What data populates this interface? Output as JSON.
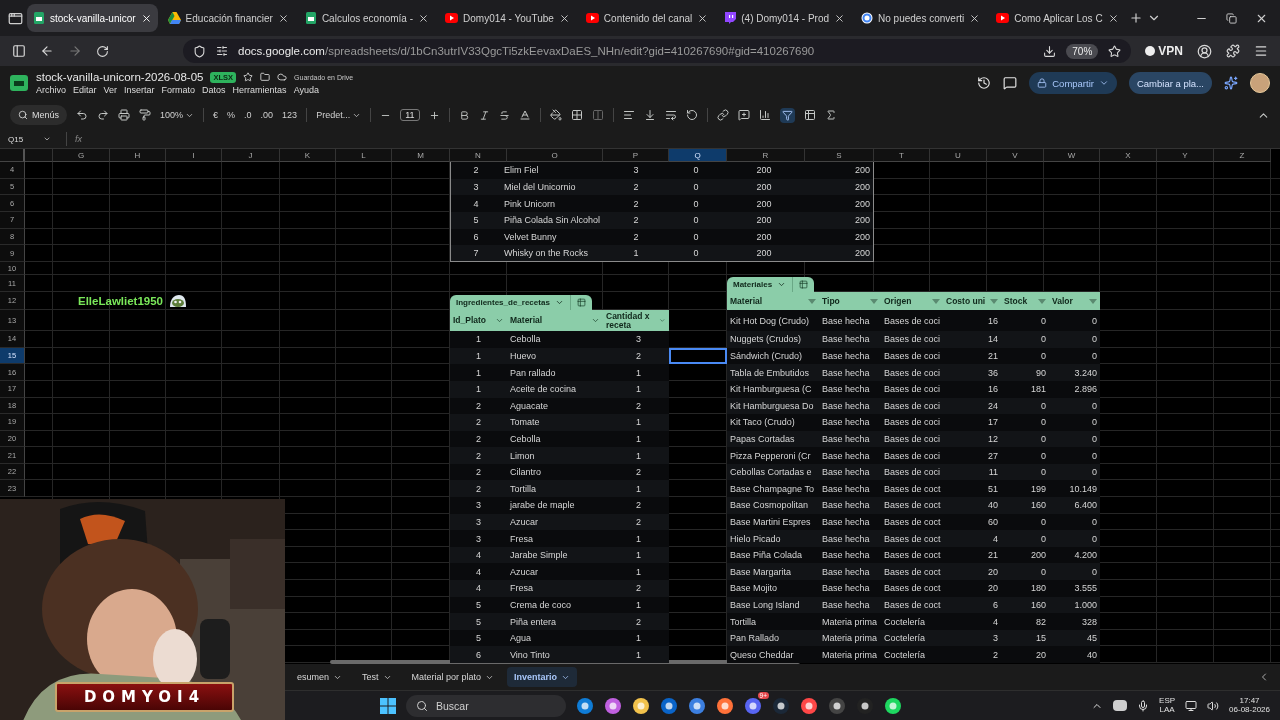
{
  "browser": {
    "tabs": [
      {
        "kind": "sheets",
        "title": "stock-vanilla-unicor",
        "selected": true
      },
      {
        "kind": "drive",
        "title": "Educación financier",
        "selected": false
      },
      {
        "kind": "sheets",
        "title": "Calculos economía -",
        "selected": false
      },
      {
        "kind": "youtube",
        "title": "Domy014 - YouTube",
        "selected": false
      },
      {
        "kind": "youtube",
        "title": "Contenido del canal",
        "selected": false
      },
      {
        "kind": "twitch",
        "title": "(4) Domy014 - Prod",
        "selected": false
      },
      {
        "kind": "google",
        "title": "No puedes converti",
        "selected": false
      },
      {
        "kind": "youtube",
        "title": "Como Aplicar Los C",
        "selected": false
      }
    ],
    "url_host": "docs.google.com",
    "url_path": "/spreadsheets/d/1bCn3utrIV33QgcTi5zkEevaxDaES_NHn/edit?gid=410267690#gid=410267690",
    "zoom": "70%",
    "vpn": "VPN"
  },
  "doc": {
    "title": "stock-vanilla-unicorn-2026-08-05",
    "badge": "XLSX",
    "save_status": "Guardado en Drive",
    "menus": [
      "Archivo",
      "Editar",
      "Ver",
      "Insertar",
      "Formato",
      "Datos",
      "Herramientas",
      "Ayuda"
    ],
    "share": "Compartir",
    "switch_button": "Cambiar a pla..."
  },
  "toolbar": {
    "search": "Menús",
    "zoom": "100%",
    "currency": "€",
    "percent": "%",
    "decrease_decimals": ".0",
    "increase_decimals": ".00",
    "number_format": "123",
    "font": "Predet...",
    "font_size": "11",
    "filter_on": true
  },
  "formula_bar": {
    "cell": "Q15",
    "label": "fx"
  },
  "grid": {
    "columns": [
      {
        "label": "G",
        "selected": false
      },
      {
        "label": "H",
        "selected": false
      },
      {
        "label": "I",
        "selected": false
      },
      {
        "label": "J",
        "selected": false
      },
      {
        "label": "K",
        "selected": false
      },
      {
        "label": "L",
        "selected": false
      },
      {
        "label": "M",
        "selected": false
      },
      {
        "label": "N",
        "selected": false
      },
      {
        "label": "O",
        "selected": false
      },
      {
        "label": "P",
        "selected": false
      },
      {
        "label": "Q",
        "selected": true
      },
      {
        "label": "R",
        "selected": false
      },
      {
        "label": "S",
        "selected": false
      },
      {
        "label": "T",
        "selected": false
      },
      {
        "label": "U",
        "selected": false
      },
      {
        "label": "V",
        "selected": false
      },
      {
        "label": "W",
        "selected": false
      },
      {
        "label": "X",
        "selected": false
      },
      {
        "label": "Y",
        "selected": false
      },
      {
        "label": "Z",
        "selected": false
      }
    ],
    "row_numbers": [
      {
        "label": "4",
        "selected": false
      },
      {
        "label": "5",
        "selected": false
      },
      {
        "label": "6",
        "selected": false
      },
      {
        "label": "7",
        "selected": false
      },
      {
        "label": "8",
        "selected": false
      },
      {
        "label": "9",
        "selected": false
      },
      {
        "label": "10",
        "selected": false
      },
      {
        "label": "11",
        "selected": false
      },
      {
        "label": "12",
        "selected": false
      },
      {
        "label": "13",
        "selected": false
      },
      {
        "label": "14",
        "selected": false
      },
      {
        "label": "15",
        "selected": true
      },
      {
        "label": "16",
        "selected": false
      },
      {
        "label": "17",
        "selected": false
      },
      {
        "label": "18",
        "selected": false
      },
      {
        "label": "19",
        "selected": false
      },
      {
        "label": "20",
        "selected": false
      },
      {
        "label": "21",
        "selected": false
      },
      {
        "label": "22",
        "selected": false
      },
      {
        "label": "23",
        "selected": false
      }
    ]
  },
  "chat": {
    "user": "ElleLawliet1950"
  },
  "summary_table": {
    "rows": [
      [
        "2",
        "Elim Fiel",
        "3",
        "0",
        "200",
        "200"
      ],
      [
        "3",
        "Miel del Unicornio",
        "2",
        "0",
        "200",
        "200"
      ],
      [
        "4",
        "Pink Unicorn",
        "2",
        "0",
        "200",
        "200"
      ],
      [
        "5",
        "Piña Colada Sin Alcohol",
        "2",
        "0",
        "200",
        "200"
      ],
      [
        "6",
        "Velvet Bunny",
        "2",
        "0",
        "200",
        "200"
      ],
      [
        "7",
        "Whisky on the Rocks",
        "1",
        "0",
        "200",
        "200"
      ]
    ]
  },
  "ingredients_table": {
    "name": "Ingredientes_de_recetas",
    "columns": [
      "Id_Plato",
      "Material",
      "Cantidad x receta"
    ],
    "rows": [
      [
        "1",
        "Cebolla",
        "3"
      ],
      [
        "1",
        "Huevo",
        "2"
      ],
      [
        "1",
        "Pan rallado",
        "1"
      ],
      [
        "1",
        "Aceite de cocina",
        "1"
      ],
      [
        "2",
        "Aguacate",
        "2"
      ],
      [
        "2",
        "Tomate",
        "1"
      ],
      [
        "2",
        "Cebolla",
        "1"
      ],
      [
        "2",
        "Limon",
        "1"
      ],
      [
        "2",
        "Cilantro",
        "2"
      ],
      [
        "2",
        "Tortilla",
        "1"
      ],
      [
        "3",
        "jarabe de maple",
        "2"
      ],
      [
        "3",
        "Azucar",
        "2"
      ],
      [
        "3",
        "Fresa",
        "1"
      ],
      [
        "4",
        "Jarabe Simple",
        "1"
      ],
      [
        "4",
        "Azucar",
        "1"
      ],
      [
        "4",
        "Fresa",
        "2"
      ],
      [
        "5",
        "Crema de coco",
        "1"
      ],
      [
        "5",
        "Piña entera",
        "2"
      ],
      [
        "5",
        "Agua",
        "1"
      ],
      [
        "6",
        "Vino Tinto",
        "1"
      ]
    ]
  },
  "materials_table": {
    "name": "Materiales",
    "columns": [
      "Material",
      "Tipo",
      "Origen",
      "Costo uni",
      "Stock",
      "Valor"
    ],
    "rows": [
      [
        "Kit Hot Dog (Crudo)",
        "Base hecha",
        "Bases de coci",
        "16",
        "0",
        "0"
      ],
      [
        "Nuggets (Crudos)",
        "Base hecha",
        "Bases de coci",
        "14",
        "0",
        "0"
      ],
      [
        "Sándwich (Crudo)",
        "Base hecha",
        "Bases de coci",
        "21",
        "0",
        "0"
      ],
      [
        "Tabla de Embutidos",
        "Base hecha",
        "Bases de coci",
        "36",
        "90",
        "3.240"
      ],
      [
        "Kit Hamburguesa (C",
        "Base hecha",
        "Bases de coci",
        "16",
        "181",
        "2.896"
      ],
      [
        "Kit Hamburguesa Do",
        "Base hecha",
        "Bases de coci",
        "24",
        "0",
        "0"
      ],
      [
        "Kit Taco (Crudo)",
        "Base hecha",
        "Bases de coci",
        "17",
        "0",
        "0"
      ],
      [
        "Papas Cortadas",
        "Base hecha",
        "Bases de coci",
        "12",
        "0",
        "0"
      ],
      [
        "Pizza Pepperoni (Cr",
        "Base hecha",
        "Bases de coci",
        "27",
        "0",
        "0"
      ],
      [
        "Cebollas Cortadas e",
        "Base hecha",
        "Bases de coci",
        "11",
        "0",
        "0"
      ],
      [
        "Base Champagne To",
        "Base hecha",
        "Bases de coct",
        "51",
        "199",
        "10.149"
      ],
      [
        "Base Cosmopolitan",
        "Base hecha",
        "Bases de coct",
        "40",
        "160",
        "6.400"
      ],
      [
        "Base Martini Espres",
        "Base hecha",
        "Bases de coct",
        "60",
        "0",
        "0"
      ],
      [
        "Hielo Picado",
        "Base hecha",
        "Bases de coct",
        "4",
        "0",
        "0"
      ],
      [
        "Base Piña Colada",
        "Base hecha",
        "Bases de coct",
        "21",
        "200",
        "4.200"
      ],
      [
        "Base Margarita",
        "Base hecha",
        "Bases de coct",
        "20",
        "0",
        "0"
      ],
      [
        "Base Mojito",
        "Base hecha",
        "Bases de coct",
        "20",
        "180",
        "3.555"
      ],
      [
        "Base Long Island",
        "Base hecha",
        "Bases de coct",
        "6",
        "160",
        "1.000"
      ],
      [
        "Tortilla",
        "Materia prima",
        "Coctelería",
        "4",
        "82",
        "328"
      ],
      [
        "Pan Rallado",
        "Materia prima",
        "Coctelería",
        "3",
        "15",
        "45"
      ],
      [
        "Queso Cheddar",
        "Materia prima",
        "Coctelería",
        "2",
        "20",
        "40"
      ]
    ]
  },
  "sheet_tabs": [
    {
      "label": "esumen",
      "selected": false
    },
    {
      "label": "Test",
      "selected": false
    },
    {
      "label": "Material por plato",
      "selected": false
    },
    {
      "label": "Inventario",
      "selected": true
    }
  ],
  "webcam": {
    "banner": "DOMYOI4"
  },
  "taskbar": {
    "search": "Buscar",
    "badge": "9+",
    "language": "ESP",
    "region": "LAA",
    "time": "17:47",
    "date": "06-08-2026"
  }
}
